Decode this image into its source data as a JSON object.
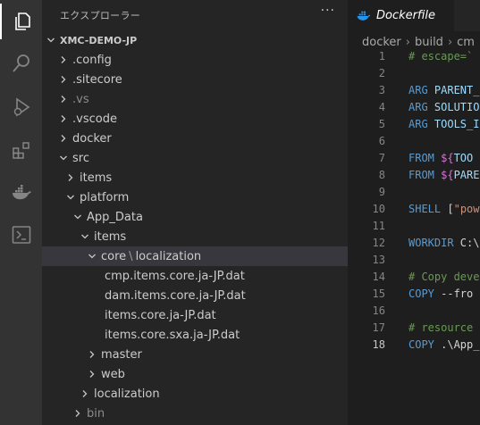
{
  "sidebar": {
    "title": "エクスプローラー",
    "more": "···",
    "tree": [
      {
        "label": "XMC-DEMO-JP",
        "depth": 0,
        "chevron": "down",
        "root": true
      },
      {
        "label": ".config",
        "depth": 1,
        "chevron": "right"
      },
      {
        "label": ".sitecore",
        "depth": 1,
        "chevron": "right"
      },
      {
        "label": ".vs",
        "depth": 1,
        "chevron": "right",
        "dim": true
      },
      {
        "label": ".vscode",
        "depth": 1,
        "chevron": "right"
      },
      {
        "label": "docker",
        "depth": 1,
        "chevron": "right"
      },
      {
        "label": "src",
        "depth": 1,
        "chevron": "down"
      },
      {
        "label": "items",
        "depth": 2,
        "chevron": "right"
      },
      {
        "label": "platform",
        "depth": 2,
        "chevron": "down"
      },
      {
        "label": "App_Data",
        "depth": 3,
        "chevron": "down"
      },
      {
        "label": "items",
        "depth": 4,
        "chevron": "down"
      },
      {
        "label": "core",
        "label2": "localization",
        "sep": "\\",
        "depth": 5,
        "chevron": "down",
        "selected": true
      },
      {
        "label": "cmp.items.core.ja-JP.dat",
        "depth": 6,
        "chevron": "none",
        "file": true
      },
      {
        "label": "dam.items.core.ja-JP.dat",
        "depth": 6,
        "chevron": "none",
        "file": true
      },
      {
        "label": "items.core.ja-JP.dat",
        "depth": 6,
        "chevron": "none",
        "file": true
      },
      {
        "label": "items.core.sxa.ja-JP.dat",
        "depth": 6,
        "chevron": "none",
        "file": true
      },
      {
        "label": "master",
        "depth": 5,
        "chevron": "right"
      },
      {
        "label": "web",
        "depth": 5,
        "chevron": "right"
      },
      {
        "label": "localization",
        "depth": 4,
        "chevron": "right"
      },
      {
        "label": "bin",
        "depth": 3,
        "chevron": "right",
        "dim": true
      }
    ]
  },
  "editor": {
    "tab_label": "Dockerfile",
    "breadcrumbs": [
      "docker",
      "build",
      "cm"
    ],
    "current_line": 18,
    "lines": [
      {
        "n": "1",
        "parts": [
          {
            "t": "# escape=`",
            "c": "cm"
          }
        ]
      },
      {
        "n": "2",
        "parts": []
      },
      {
        "n": "3",
        "parts": [
          {
            "t": "ARG ",
            "c": "kw"
          },
          {
            "t": "PARENT_",
            "c": "var"
          }
        ]
      },
      {
        "n": "4",
        "parts": [
          {
            "t": "ARG ",
            "c": "kw"
          },
          {
            "t": "SOLUTIO",
            "c": "var"
          }
        ]
      },
      {
        "n": "5",
        "parts": [
          {
            "t": "ARG ",
            "c": "kw"
          },
          {
            "t": "TOOLS_I",
            "c": "var"
          }
        ]
      },
      {
        "n": "6",
        "parts": []
      },
      {
        "n": "7",
        "parts": [
          {
            "t": "FROM ",
            "c": "kw"
          },
          {
            "t": "${",
            "c": "brace"
          },
          {
            "t": "TOO",
            "c": "var"
          }
        ]
      },
      {
        "n": "8",
        "parts": [
          {
            "t": "FROM ",
            "c": "kw"
          },
          {
            "t": "${",
            "c": "brace"
          },
          {
            "t": "PARE",
            "c": "var"
          }
        ]
      },
      {
        "n": "9",
        "parts": []
      },
      {
        "n": "10",
        "parts": [
          {
            "t": "SHELL ",
            "c": "kw"
          },
          {
            "t": "[",
            "c": "txt"
          },
          {
            "t": "\"pow",
            "c": "str"
          }
        ]
      },
      {
        "n": "11",
        "parts": []
      },
      {
        "n": "12",
        "parts": [
          {
            "t": "WORKDIR ",
            "c": "kw"
          },
          {
            "t": "C:\\",
            "c": "txt"
          }
        ]
      },
      {
        "n": "13",
        "parts": []
      },
      {
        "n": "14",
        "parts": [
          {
            "t": "# Copy deve",
            "c": "cm"
          }
        ]
      },
      {
        "n": "15",
        "parts": [
          {
            "t": "COPY ",
            "c": "kw"
          },
          {
            "t": "--fro",
            "c": "txt"
          }
        ]
      },
      {
        "n": "16",
        "parts": []
      },
      {
        "n": "17",
        "parts": [
          {
            "t": "# resource",
            "c": "cm"
          }
        ]
      },
      {
        "n": "18",
        "parts": [
          {
            "t": "COPY ",
            "c": "kw"
          },
          {
            "t": ".\\App_",
            "c": "txt"
          }
        ]
      }
    ]
  },
  "activity_bar": [
    "files-icon",
    "search-icon",
    "run-debug-icon",
    "extensions-icon",
    "docker-icon",
    "terminal-icon"
  ],
  "colors": {
    "accent": "#ffffff",
    "docker": "#2496ed",
    "selection": "#37373d"
  }
}
